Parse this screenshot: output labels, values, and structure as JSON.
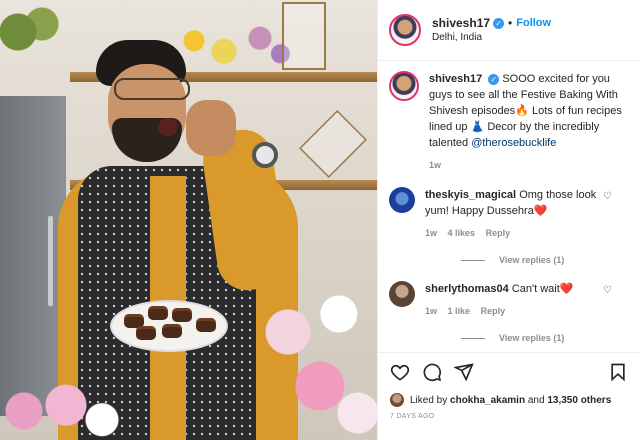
{
  "header": {
    "username": "shivesh17",
    "separator": "•",
    "follow_label": "Follow",
    "location": "Delhi, India",
    "verified_mark": "✓"
  },
  "caption": {
    "username": "shivesh17",
    "text_part1": "SOOO excited for you guys to see all the Festive Baking With Shivesh episodes🔥 Lots of fun recipes lined up 👗 Decor by the incredibly talented ",
    "mention": "@therosebucklife",
    "time": "1w"
  },
  "comments": [
    {
      "username": "theskyis_magical",
      "text": "Omg those look yum! Happy Dussehra❤️",
      "time": "1w",
      "likes": "4 likes",
      "reply_label": "Reply",
      "view_replies": "View replies (1)"
    },
    {
      "username": "sherlythomas04",
      "text": "Can't wait❤️",
      "time": "1w",
      "likes": "1 like",
      "reply_label": "Reply",
      "view_replies": "View replies (1)"
    }
  ],
  "actions": {
    "icons": [
      "heart-icon",
      "comment-icon",
      "share-icon",
      "bookmark-icon"
    ],
    "liked_by_prefix": "Liked by",
    "liked_by_user": "chokha_akamin",
    "liked_by_and": "and",
    "liked_by_count": "13,350 others",
    "timestamp": "7 DAYS AGO"
  },
  "colors": {
    "accent": "#0095f6",
    "verified": "#3897f0",
    "text": "#262626",
    "muted": "#8e8e8e"
  }
}
